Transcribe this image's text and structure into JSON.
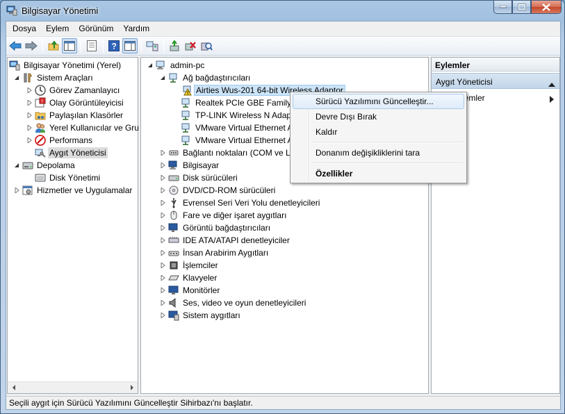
{
  "window": {
    "title": "Bilgisayar Yönetimi"
  },
  "menu": [
    "Dosya",
    "Eylem",
    "Görünüm",
    "Yardım"
  ],
  "left_tree": {
    "root": "Bilgisayar Yönetimi (Yerel)",
    "system_tools": "Sistem Araçları",
    "task_scheduler": "Görev Zamanlayıcı",
    "event_viewer": "Olay Görüntüleyicisi",
    "shared_folders": "Paylaşılan Klasörler",
    "local_users": "Yerel Kullanıcılar ve Gru",
    "performance": "Performans",
    "device_manager": "Aygıt Yöneticisi",
    "storage": "Depolama",
    "disk_management": "Disk Yönetimi",
    "services": "Hizmetler ve Uygulamalar"
  },
  "device_tree": {
    "root": "admin-pc",
    "network_adapters": "Ağ bağdaştırıcıları",
    "adapters": [
      "Airties Wus-201 64-bit Wireless Adaptor",
      "Realtek PCIe GBE Family C",
      "TP-LINK Wireless N Adapt",
      "VMware Virtual Ethernet A",
      "VMware Virtual Ethernet A"
    ],
    "categories": [
      "Bağlantı noktaları (COM ve LP",
      "Bilgisayar",
      "Disk sürücüleri",
      "DVD/CD-ROM sürücüleri",
      "Evrensel Seri Veri Yolu denetleyicileri",
      "Fare ve diğer işaret aygıtları",
      "Görüntü bağdaştırıcıları",
      "IDE ATA/ATAPI denetleyiciler",
      "İnsan Arabirim Aygıtları",
      "İşlemciler",
      "Klavyeler",
      "Monitörler",
      "Ses, video ve oyun denetleyicileri",
      "Sistem aygıtları"
    ]
  },
  "context_menu": {
    "update_driver": "Sürücü Yazılımını Güncelleştir...",
    "disable": "Devre Dışı Bırak",
    "uninstall": "Kaldır",
    "scan": "Donanım değişikliklerini tara",
    "properties": "Özellikler"
  },
  "actions": {
    "header": "Eylemler",
    "section": "Aygıt Yöneticisi",
    "more": "ylemler"
  },
  "status": "Seçili aygıt için Sürücü Yazılımını Güncelleştir Sihirbazı'nı başlatır."
}
